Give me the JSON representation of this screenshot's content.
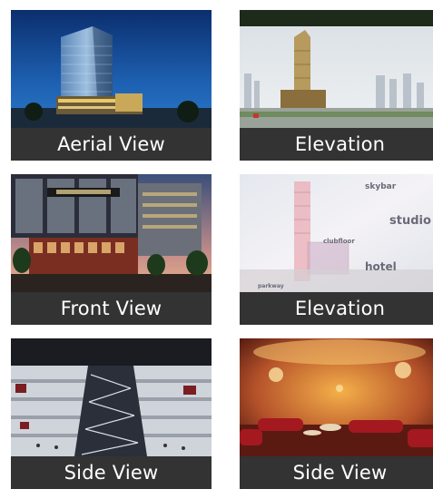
{
  "gallery": {
    "tiles": [
      {
        "caption": "Aerial View"
      },
      {
        "caption": "Elevation"
      },
      {
        "caption": "Front View"
      },
      {
        "caption": "Elevation",
        "labels": {
          "skybar": "skybar",
          "studio": "studio",
          "clubfloor": "clubfloor",
          "hotel": "hotel",
          "parkway": "parkway"
        }
      },
      {
        "caption": "Side View"
      },
      {
        "caption": "Side View"
      }
    ]
  },
  "colors": {
    "caption_bg": "#333333",
    "caption_text": "#ffffff"
  }
}
